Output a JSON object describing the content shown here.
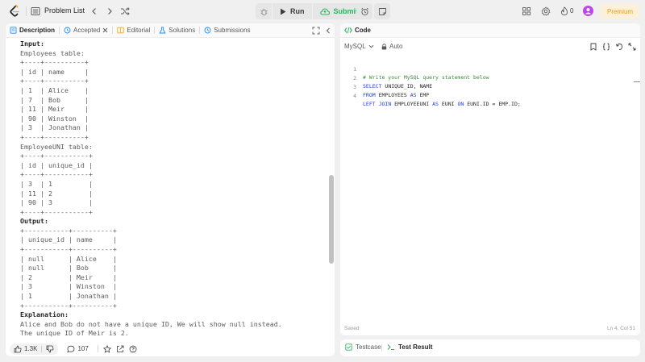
{
  "topbar": {
    "problem_list_label": "Problem List",
    "run_label": "Run",
    "submit_label": "Submit",
    "streak_count": "0",
    "premium_label": "Premium"
  },
  "left_panel": {
    "tabs": [
      {
        "label": "Description",
        "icon": "description-icon"
      },
      {
        "label": "Accepted",
        "icon": "history-icon"
      },
      {
        "label": "Editorial",
        "icon": "editorial-icon"
      },
      {
        "label": "Solutions",
        "icon": "flask-icon"
      },
      {
        "label": "Submissions",
        "icon": "history-icon"
      }
    ],
    "input_heading": "Input:",
    "employees_caption": "Employees table:",
    "employees_table": "+----+----------+\n| id | name     |\n+----+----------+\n| 1  | Alice    |\n| 7  | Bob      |\n| 11 | Meir     |\n| 90 | Winston  |\n| 3  | Jonathan |\n+----+----------+",
    "employeeuni_caption": "EmployeeUNI table:",
    "employeeuni_table": "+----+-----------+\n| id | unique_id |\n+----+-----------+\n| 3  | 1         |\n| 11 | 2         |\n| 90 | 3         |\n+----+-----------+",
    "output_heading": "Output:",
    "output_table": "+-----------+----------+\n| unique_id | name     |\n+-----------+----------+\n| null      | Alice    |\n| null      | Bob      |\n| 2         | Meir     |\n| 3         | Winston  |\n| 1         | Jonathan |\n+-----------+----------+",
    "explanation_heading": "Explanation:",
    "explanation_text": "Alice and Bob do not have a unique ID, We will show null instead.\nThe unique ID of Meir is 2.",
    "footer": {
      "likes": "1.3K",
      "comments": "107"
    }
  },
  "code_panel": {
    "title": "Code",
    "language": "MySQL",
    "auto_label": "Auto",
    "lines": [
      {
        "num": "1",
        "text": "# Write your MySQL query statement below"
      },
      {
        "num": "2",
        "text": "SELECT UNIQUE_ID, NAME"
      },
      {
        "num": "3",
        "text": "FROM EMPLOYEES AS EMP"
      },
      {
        "num": "4",
        "text": "LEFT JOIN EMPLOYEEUNI AS EUNI ON EUNI.ID = EMP.ID;"
      }
    ],
    "status": "Saved",
    "cursor_position": "Ln 4, Col 51"
  },
  "bottom_panel": {
    "testcase_label": "Testcase",
    "test_result_label": "Test Result"
  },
  "colors": {
    "submit_green": "#2db55d",
    "premium_text": "#e89b12",
    "premium_bg": "#fdf0d9",
    "keyword_blue": "#1f3fd6",
    "comment_green": "#3a8a3a",
    "avatar": "#c144e8"
  }
}
